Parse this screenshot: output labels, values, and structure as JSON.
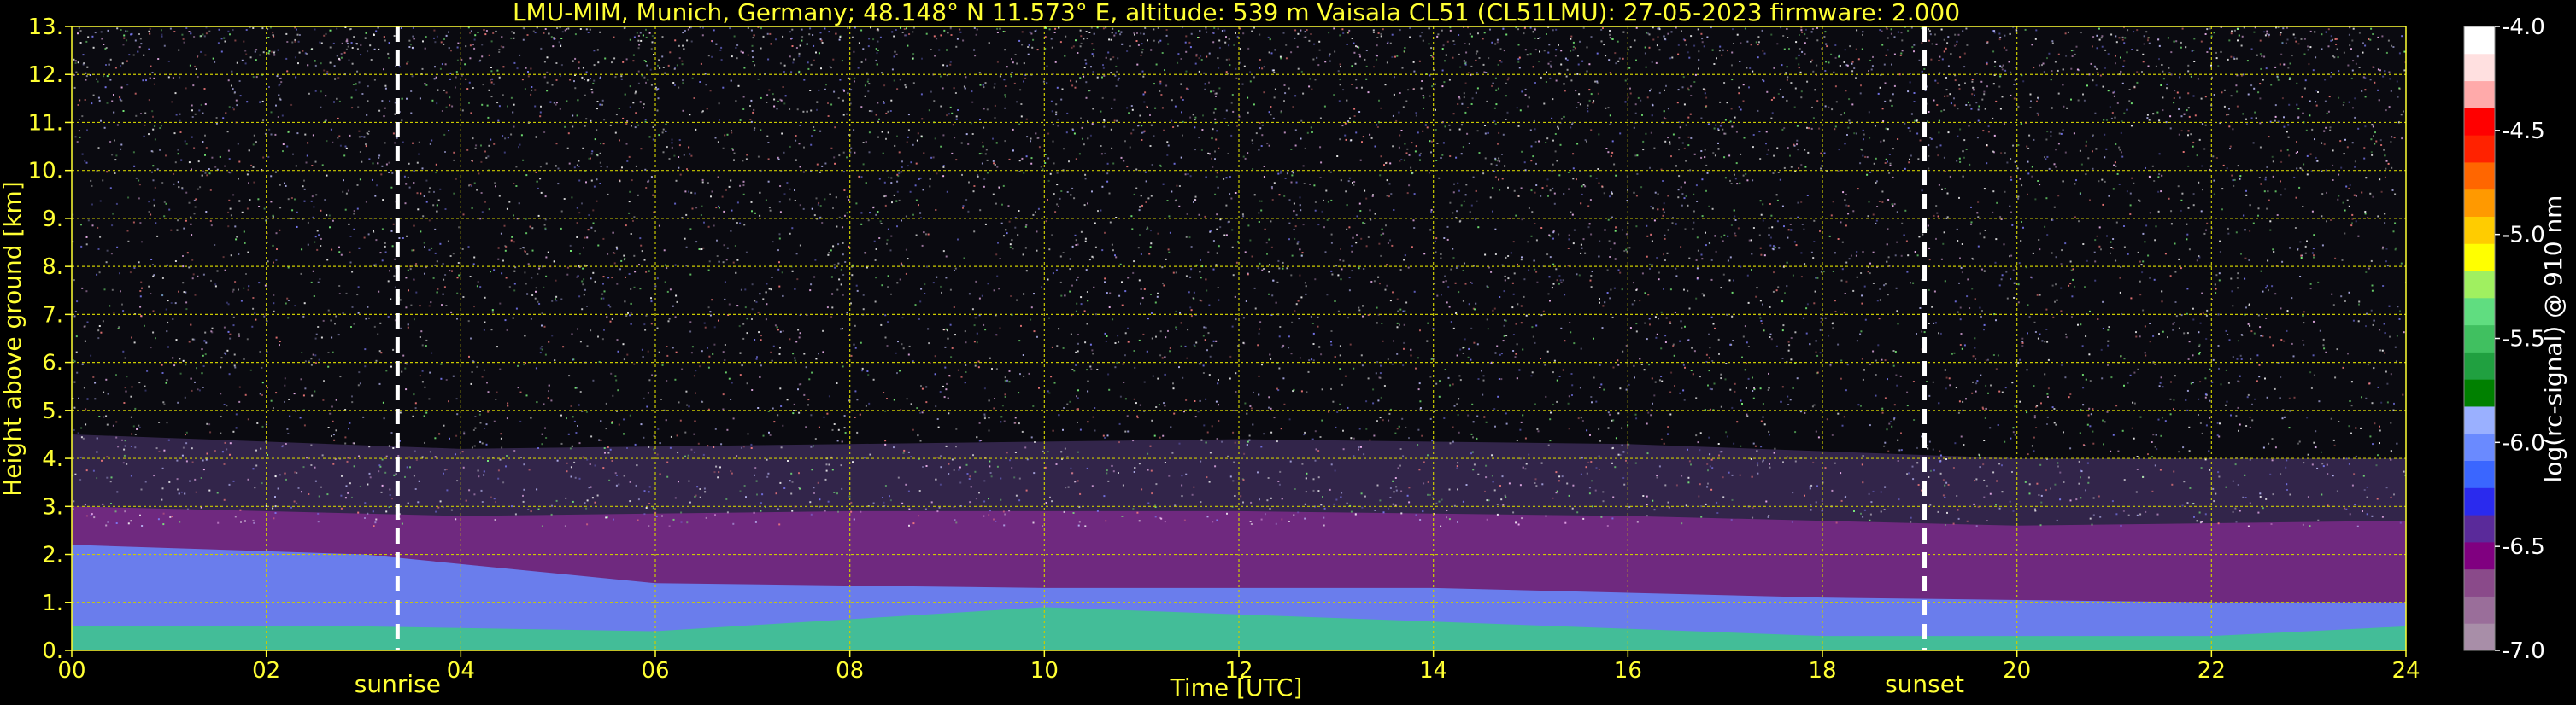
{
  "chart_data": {
    "type": "heatmap",
    "title": "LMU-MIM, Munich, Germany; 48.148° N 11.573° E, altitude: 539 m    Vaisala CL51 (CL51LMU): 27-05-2023    firmware: 2.000",
    "xlabel": "Time [UTC]",
    "ylabel": "Height above ground [km]",
    "xlim": [
      0,
      24
    ],
    "ylim": [
      0,
      13
    ],
    "x_ticks": [
      "00",
      "02",
      "04",
      "06",
      "08",
      "10",
      "12",
      "14",
      "16",
      "18",
      "20",
      "22",
      "24"
    ],
    "y_ticks": [
      "0.",
      "1.",
      "2.",
      "3.",
      "4.",
      "5.",
      "6.",
      "7.",
      "8.",
      "9.",
      "10.",
      "11.",
      "12.",
      "13."
    ],
    "grid": true,
    "markers": [
      {
        "label": "sunrise",
        "x": 3.35
      },
      {
        "label": "sunset",
        "x": 19.05
      }
    ],
    "colorbar": {
      "label": "log(rc-signal) @ 910 nm",
      "range": [
        -7.0,
        -4.0
      ],
      "ticks": [
        "-7.0",
        "-6.5",
        "-6.0",
        "-5.5",
        "-5.0",
        "-4.5",
        "-4.0"
      ],
      "colors": [
        "#a88ea8",
        "#9a6e9a",
        "#8a4a8a",
        "#800080",
        "#5a2a9a",
        "#2a2aee",
        "#3a66ff",
        "#6a8aff",
        "#9ab0ff",
        "#008000",
        "#20a040",
        "#40c060",
        "#60dd80",
        "#a0f060",
        "#ffff00",
        "#ffcc00",
        "#ff9900",
        "#ff6600",
        "#ff2200",
        "#ff0000",
        "#ffaaaa",
        "#ffe0e0",
        "#ffffff"
      ]
    },
    "layers": [
      {
        "x": [
          0,
          3,
          6,
          10,
          14,
          18,
          22,
          24
        ],
        "y_top": [
          0.5,
          0.5,
          0.4,
          0.9,
          0.6,
          0.3,
          0.3,
          0.5
        ],
        "color": "#3cc88a"
      },
      {
        "x": [
          0,
          3,
          6,
          10,
          14,
          18,
          22,
          24
        ],
        "y_top": [
          2.2,
          2.0,
          1.4,
          1.3,
          1.3,
          1.1,
          1.0,
          1.0
        ],
        "color": "#6a8cff"
      },
      {
        "x": [
          0,
          4,
          8,
          12,
          16,
          20,
          24
        ],
        "y_top": [
          3.0,
          2.8,
          2.9,
          2.9,
          2.8,
          2.6,
          2.7
        ],
        "color": "#7a2a88"
      },
      {
        "x": [
          0,
          4,
          8,
          12,
          16,
          20,
          24
        ],
        "y_top": [
          4.5,
          4.2,
          4.3,
          4.4,
          4.3,
          4.0,
          4.0
        ],
        "color": "#3a2a55"
      }
    ],
    "colors": {
      "axes": "#ffff33",
      "grid": "#cccc00",
      "background": "#000000",
      "marker": "#ffffff"
    }
  }
}
